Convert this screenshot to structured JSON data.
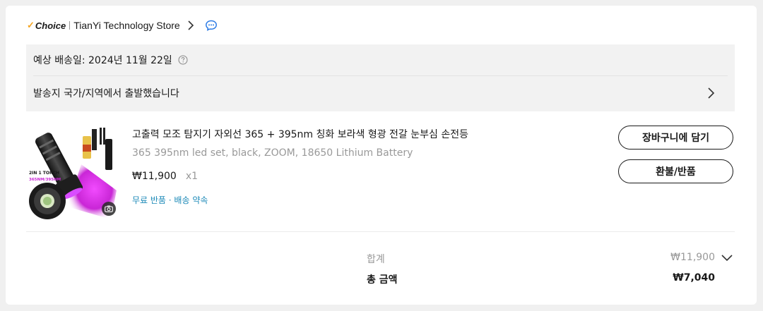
{
  "store": {
    "badge_check": "✓",
    "badge_label": "Choice",
    "name": "TianYi Technology Store",
    "icons": [
      "chevron-right-icon",
      "chat-icon"
    ]
  },
  "delivery": {
    "estimate": "예상 배송일: 2024년 11월 22일",
    "ship_from": "발송지 국가/지역에서 출발했습니다"
  },
  "product": {
    "title": "고출력 모조 탐지기 자외선 365 + 395nm 칭화 보라색 형광 전갈 눈부심 손전등",
    "variant": "365 395nm led set, black, ZOOM, 18650 Lithium Battery",
    "price": "₩11,900",
    "quantity": "x1",
    "tags": "무료 반품 · 배송 약속",
    "image_text": {
      "torch_label": "2IN 1 TORCH",
      "wavelength": "365NM/395NM"
    }
  },
  "actions": {
    "add_to_cart": "장바구니에 담기",
    "refund_return": "환불/반품"
  },
  "summary": {
    "subtotal_label": "합계",
    "subtotal_value": "₩11,900",
    "total_label": "총 금액",
    "total_value": "₩7,040"
  },
  "colors": {
    "choice_check": "#f5a623",
    "link_blue": "#1d8ab8",
    "chat_blue": "#2c7be5",
    "muted": "#999999"
  }
}
